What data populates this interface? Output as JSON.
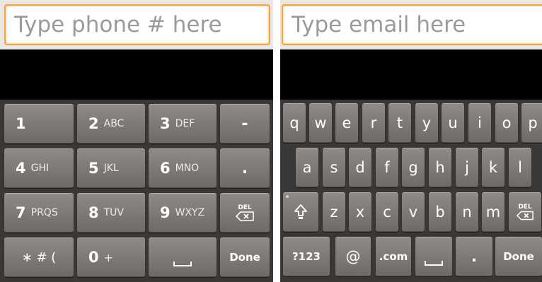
{
  "phone": {
    "placeholder": "Type phone # here",
    "keys": {
      "k1": {
        "main": "1",
        "sub": ""
      },
      "k2": {
        "main": "2",
        "sub": "ABC"
      },
      "k3": {
        "main": "3",
        "sub": "DEF"
      },
      "dash": "-",
      "k4": {
        "main": "4",
        "sub": "GHI"
      },
      "k5": {
        "main": "5",
        "sub": "JKL"
      },
      "k6": {
        "main": "6",
        "sub": "MNO"
      },
      "period": ".",
      "k7": {
        "main": "7",
        "sub": "PRQS"
      },
      "k8": {
        "main": "8",
        "sub": "TUV"
      },
      "k9": {
        "main": "9",
        "sub": "WXYZ"
      },
      "del": "DEL",
      "symbols": "∗ # (",
      "k0": {
        "main": "0",
        "sub": "+"
      },
      "done": "Done"
    }
  },
  "email": {
    "placeholder": "Type email here",
    "row1": [
      "q",
      "w",
      "e",
      "r",
      "t",
      "y",
      "u",
      "i",
      "o",
      "p"
    ],
    "row2": [
      "a",
      "s",
      "d",
      "f",
      "g",
      "h",
      "j",
      "k",
      "l"
    ],
    "row3": [
      "z",
      "x",
      "c",
      "v",
      "b",
      "n",
      "m"
    ],
    "del": "DEL",
    "mode": "?123",
    "at": "@",
    "dotcom": ".com",
    "period": ".",
    "done": "Done"
  },
  "colors": {
    "field_border": "#f0a43c",
    "key_face": "#7f7a76",
    "keyboard_bg": "#3a3836",
    "screen_bg": "#000000"
  },
  "icons": [
    "shift-icon",
    "backspace-icon",
    "space-icon"
  ]
}
